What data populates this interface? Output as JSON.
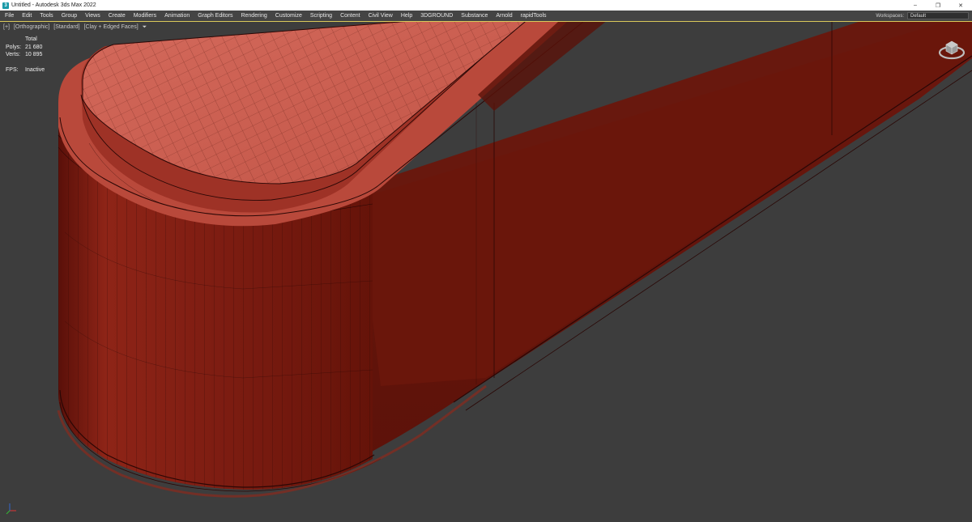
{
  "window": {
    "title": "Untitled - Autodesk 3ds Max 2022",
    "icon": "3ds-max-app-icon",
    "controls": {
      "minimize": "–",
      "restore": "❐",
      "close": "✕"
    }
  },
  "menubar": {
    "items": [
      {
        "label": "File"
      },
      {
        "label": "Edit"
      },
      {
        "label": "Tools"
      },
      {
        "label": "Group"
      },
      {
        "label": "Views"
      },
      {
        "label": "Create"
      },
      {
        "label": "Modifiers"
      },
      {
        "label": "Animation"
      },
      {
        "label": "Graph Editors"
      },
      {
        "label": "Rendering"
      },
      {
        "label": "Customize"
      },
      {
        "label": "Scripting"
      },
      {
        "label": "Content"
      },
      {
        "label": "Civil View"
      },
      {
        "label": "Help"
      },
      {
        "label": "3DGROUND"
      },
      {
        "label": "Substance"
      },
      {
        "label": "Arnold"
      },
      {
        "label": "rapidTools"
      }
    ],
    "workspaces_label": "Workspaces:",
    "workspaces_value": "Default"
  },
  "viewport": {
    "label_parts": [
      "[+]",
      "[Orthographic]",
      "[Standard]",
      "[Clay + Edged Faces]"
    ],
    "filter_icon": "funnel-icon",
    "stats": {
      "header": "Total",
      "polys_label": "Polys:",
      "polys_value": "21 680",
      "verts_label": "Verts:",
      "verts_value": "10 895",
      "fps_label": "FPS:",
      "fps_value": "Inactive"
    },
    "colors": {
      "background": "#3d3d3d",
      "model_base": "#7a1a12",
      "model_top": "#c9574a",
      "wire": "#2a0705",
      "active_border": "#d9c85a"
    }
  }
}
